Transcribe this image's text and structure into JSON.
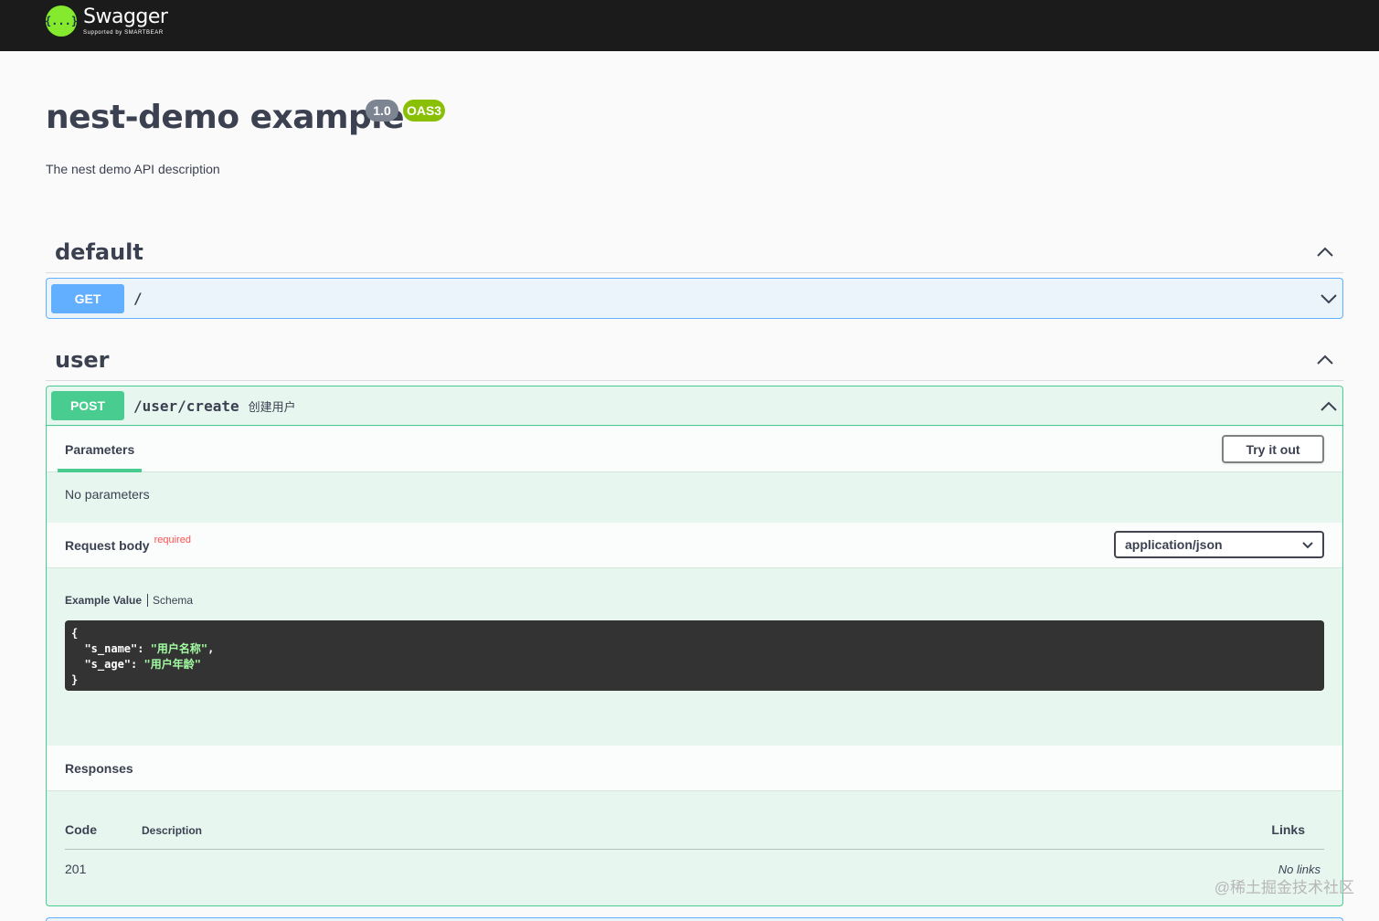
{
  "topbar": {
    "logo_name": "Swagger",
    "logo_sub": "Supported by SMARTBEAR",
    "logo_glyph": "{...}"
  },
  "info": {
    "title": "nest-demo example",
    "version": "1.0",
    "oas": "OAS3",
    "description": "The nest demo API description"
  },
  "tags": [
    {
      "name": "default"
    },
    {
      "name": "user"
    }
  ],
  "operations": [
    {
      "method": "GET",
      "path": "/",
      "description": ""
    },
    {
      "method": "POST",
      "path": "/user/create",
      "description": "创建用户"
    }
  ],
  "post_detail": {
    "params_tab": "Parameters",
    "try_button": "Try it out",
    "no_params": "No parameters",
    "request_body": "Request body",
    "required": "required",
    "content_type": "application/json",
    "example_tab": "Example Value",
    "schema_tab": "Schema",
    "example_code": {
      "open": "{",
      "line1_key": "\"s_name\"",
      "line1_value": "\"用户名称\"",
      "line2_key": "\"s_age\"",
      "line2_value": "\"用户年龄\"",
      "close": "}"
    },
    "responses_title": "Responses",
    "responses_table": {
      "col_code": "Code",
      "col_description": "Description",
      "col_links": "Links",
      "rows": [
        {
          "code": "201",
          "links": "No links"
        }
      ]
    }
  },
  "watermark": "@稀土掘金技术社区",
  "colors": {
    "get": "#61affe",
    "post": "#49cc90",
    "version_badge": "#7d8492",
    "oas_badge": "#89bf04",
    "required": "#ff4f4f"
  }
}
